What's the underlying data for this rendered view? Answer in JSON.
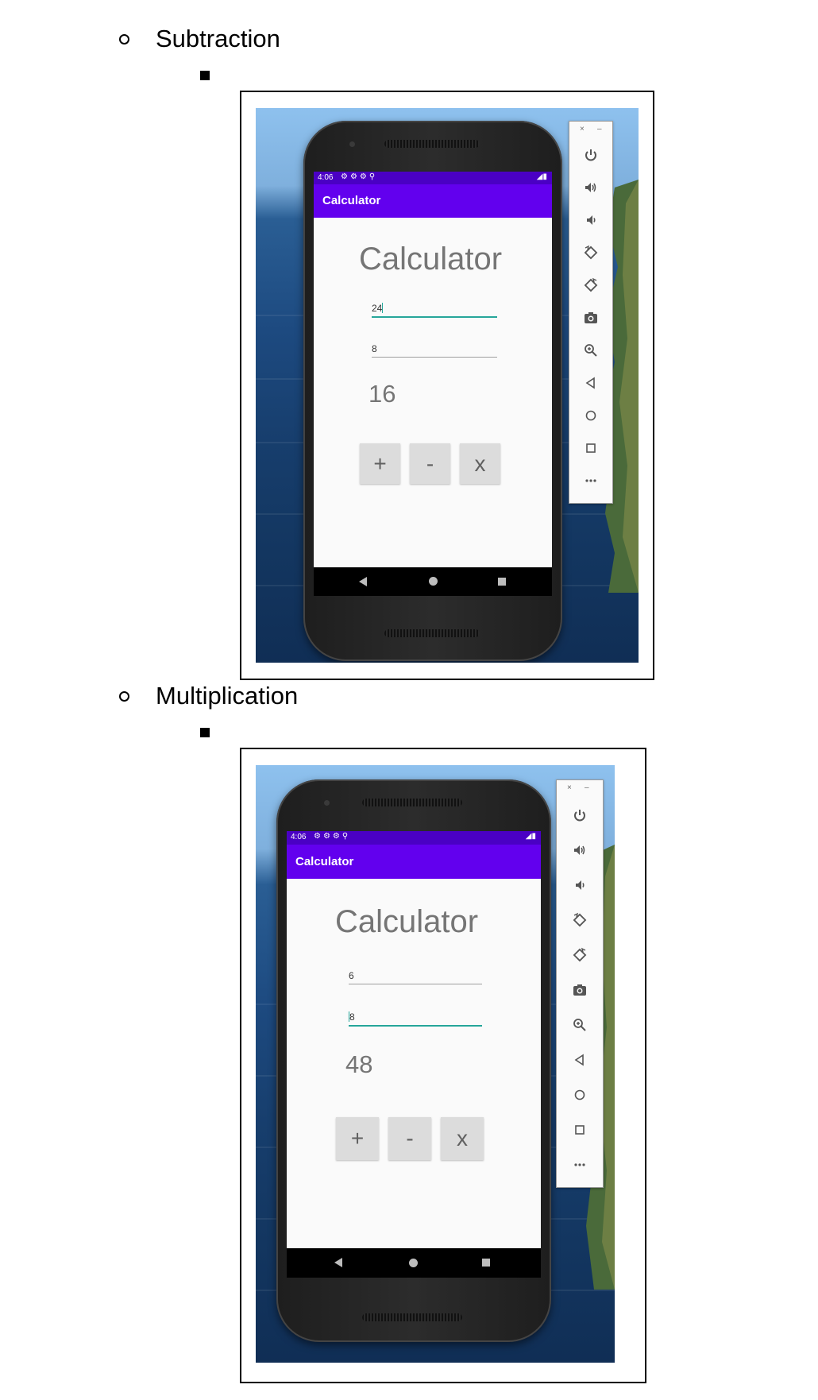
{
  "sections": [
    {
      "heading": "Subtraction",
      "app": {
        "status_time": "4:06",
        "appbar_title": "Calculator",
        "title": "Calculator",
        "input1": "24",
        "input2": "8",
        "result": "16",
        "buttons": [
          "+",
          "-",
          "x"
        ]
      }
    },
    {
      "heading": "Multiplication",
      "app": {
        "status_time": "4:06",
        "appbar_title": "Calculator",
        "title": "Calculator",
        "input1": "6",
        "input2": "8",
        "result": "48",
        "buttons": [
          "+",
          "-",
          "x"
        ]
      }
    }
  ],
  "emulator_toolbar": {
    "close": "×",
    "minimize": "–",
    "tools": [
      "power-icon",
      "volume-up-icon",
      "volume-down-icon",
      "rotate-left-icon",
      "rotate-right-icon",
      "camera-icon",
      "zoom-icon",
      "back-icon",
      "home-icon",
      "overview-icon",
      "more-icon"
    ]
  },
  "colors": {
    "status_bar": "#4a00c4",
    "app_bar": "#6200ee",
    "focus_underline": "#26a69a",
    "button_bg": "#dcdcdc",
    "text_gray": "#757575"
  }
}
